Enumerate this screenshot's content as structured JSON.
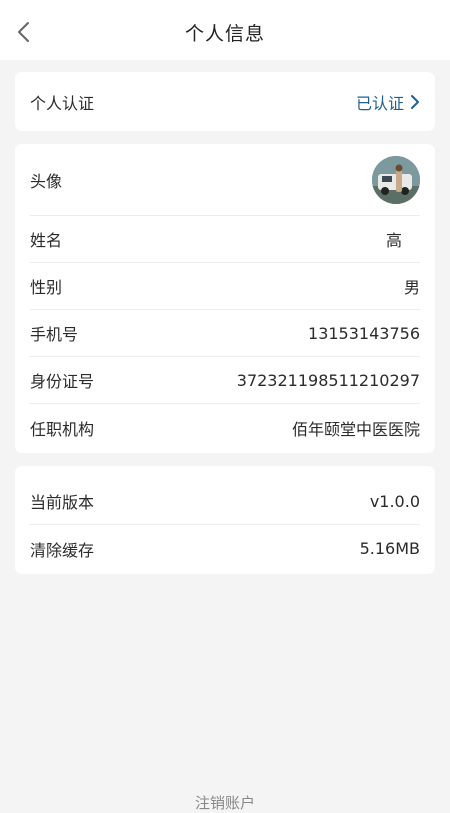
{
  "header": {
    "back_icon": "chevron-left-icon",
    "title": "个人信息"
  },
  "auth_card": {
    "label": "个人认证",
    "status": "已认证",
    "chevron_icon": "chevron-right-icon",
    "accent_color": "#1f5f92"
  },
  "profile": {
    "avatar_label": "头像",
    "fields": [
      {
        "label": "姓名",
        "value": "高"
      },
      {
        "label": "性别",
        "value": "男"
      },
      {
        "label": "手机号",
        "value": "13153143756"
      },
      {
        "label": "身份证号",
        "value": "372321198511210297"
      },
      {
        "label": "任职机构",
        "value": "佰年颐堂中医医院"
      }
    ]
  },
  "settings": {
    "items": [
      {
        "label": "当前版本",
        "value": "v1.0.0"
      },
      {
        "label": "清除缓存",
        "value": "5.16MB"
      }
    ]
  },
  "footer": {
    "logout_label": "注销账户"
  }
}
